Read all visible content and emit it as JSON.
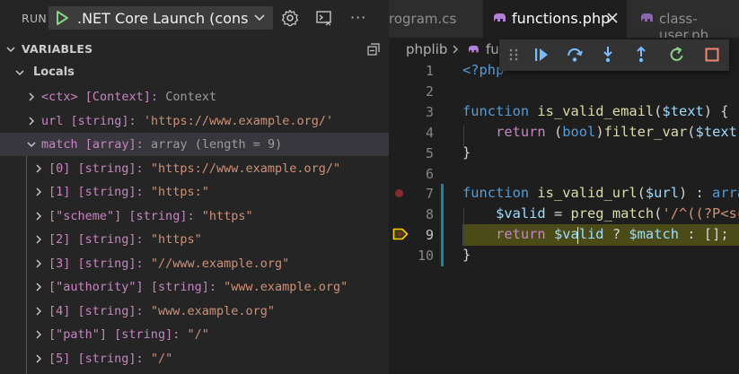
{
  "run": {
    "label": "RUN",
    "config": ".NET Core Launch (console)"
  },
  "variables": {
    "title": "VARIABLES",
    "locals_label": "Locals",
    "rows": [
      {
        "name": "<ctx>",
        "type": "[Context]:",
        "value": "Context",
        "value_kind": "plain"
      },
      {
        "name": "url",
        "type": "[string]:",
        "value": "'https://www.example.org/'",
        "value_kind": "str"
      },
      {
        "name": "match",
        "type": "[array]:",
        "value": "array (length = 9)",
        "value_kind": "plain"
      },
      {
        "name": "[0]",
        "type": "[string]:",
        "value": "\"https://www.example.org/\"",
        "value_kind": "str"
      },
      {
        "name": "[1]",
        "type": "[string]:",
        "value": "\"https:\"",
        "value_kind": "str"
      },
      {
        "name": "[\"scheme\"]",
        "type": "[string]:",
        "value": "\"https\"",
        "value_kind": "str"
      },
      {
        "name": "[2]",
        "type": "[string]:",
        "value": "\"https\"",
        "value_kind": "str"
      },
      {
        "name": "[3]",
        "type": "[string]:",
        "value": "\"//www.example.org\"",
        "value_kind": "str"
      },
      {
        "name": "[\"authority\"]",
        "type": "[string]:",
        "value": "\"www.example.org\"",
        "value_kind": "str"
      },
      {
        "name": "[4]",
        "type": "[string]:",
        "value": "\"www.example.org\"",
        "value_kind": "str"
      },
      {
        "name": "[\"path\"]",
        "type": "[string]:",
        "value": "\"/\"",
        "value_kind": "str"
      },
      {
        "name": "[5]",
        "type": "[string]:",
        "value": "\"/\"",
        "value_kind": "str"
      }
    ]
  },
  "tabs": [
    {
      "label": "rogram.cs",
      "active": false
    },
    {
      "label": "functions.php",
      "active": true
    },
    {
      "label": "class-user.ph",
      "active": false
    }
  ],
  "breadcrumb": {
    "folder": "phplib",
    "file": "fu"
  },
  "debug_toolbar": {
    "buttons": [
      "drag-handle-icon",
      "continue-icon",
      "step-over-icon",
      "step-into-icon",
      "step-out-icon",
      "restart-icon",
      "stop-icon"
    ]
  },
  "editor": {
    "current_line": 9,
    "breakpoint_line": 7,
    "lines": [
      {
        "n": "1",
        "tokens": [
          {
            "t": "<?php",
            "c": "blue"
          }
        ]
      },
      {
        "n": "2",
        "tokens": []
      },
      {
        "n": "3",
        "tokens": [
          {
            "t": "function ",
            "c": "blue"
          },
          {
            "t": "is_valid_email",
            "c": "fn"
          },
          {
            "t": "(",
            "c": "plain"
          },
          {
            "t": "$text",
            "c": "var"
          },
          {
            "t": ") {",
            "c": "plain"
          }
        ]
      },
      {
        "n": "4",
        "tokens": [
          {
            "t": "    ",
            "c": "plain"
          },
          {
            "t": "return",
            "c": "ctrl"
          },
          {
            "t": " (",
            "c": "plain"
          },
          {
            "t": "bool",
            "c": "blue"
          },
          {
            "t": ")",
            "c": "plain"
          },
          {
            "t": "filter_var",
            "c": "fn"
          },
          {
            "t": "(",
            "c": "plain"
          },
          {
            "t": "$text",
            "c": "var"
          },
          {
            "t": ",",
            "c": "plain"
          }
        ]
      },
      {
        "n": "5",
        "tokens": [
          {
            "t": "}",
            "c": "plain"
          }
        ]
      },
      {
        "n": "6",
        "tokens": []
      },
      {
        "n": "7",
        "tokens": [
          {
            "t": "function ",
            "c": "blue"
          },
          {
            "t": "is_valid_url",
            "c": "fn"
          },
          {
            "t": "(",
            "c": "plain"
          },
          {
            "t": "$url",
            "c": "var"
          },
          {
            "t": ") : ",
            "c": "plain"
          },
          {
            "t": "arra",
            "c": "blue"
          }
        ]
      },
      {
        "n": "8",
        "tokens": [
          {
            "t": "    ",
            "c": "plain"
          },
          {
            "t": "$valid",
            "c": "var"
          },
          {
            "t": " = ",
            "c": "plain"
          },
          {
            "t": "preg_match",
            "c": "fn"
          },
          {
            "t": "(",
            "c": "plain"
          },
          {
            "t": "'/^((?P<sc",
            "c": "str"
          }
        ]
      },
      {
        "n": "9",
        "tokens": [
          {
            "t": "    ",
            "c": "plain"
          },
          {
            "t": "return",
            "c": "ctrl"
          },
          {
            "t": " ",
            "c": "plain"
          },
          {
            "t": "$valid",
            "c": "var"
          },
          {
            "t": " ? ",
            "c": "plain"
          },
          {
            "t": "$match",
            "c": "var"
          },
          {
            "t": " : [];",
            "c": "plain"
          }
        ]
      },
      {
        "n": "10",
        "tokens": [
          {
            "t": "}",
            "c": "plain"
          }
        ]
      }
    ]
  },
  "colors": {
    "accent": "#1b81a8",
    "current_line_bg": "#4b4b18",
    "breakpoint": "#8a2a2a",
    "continue": "#75beff",
    "restart": "#89d185",
    "stop": "#f48771"
  }
}
